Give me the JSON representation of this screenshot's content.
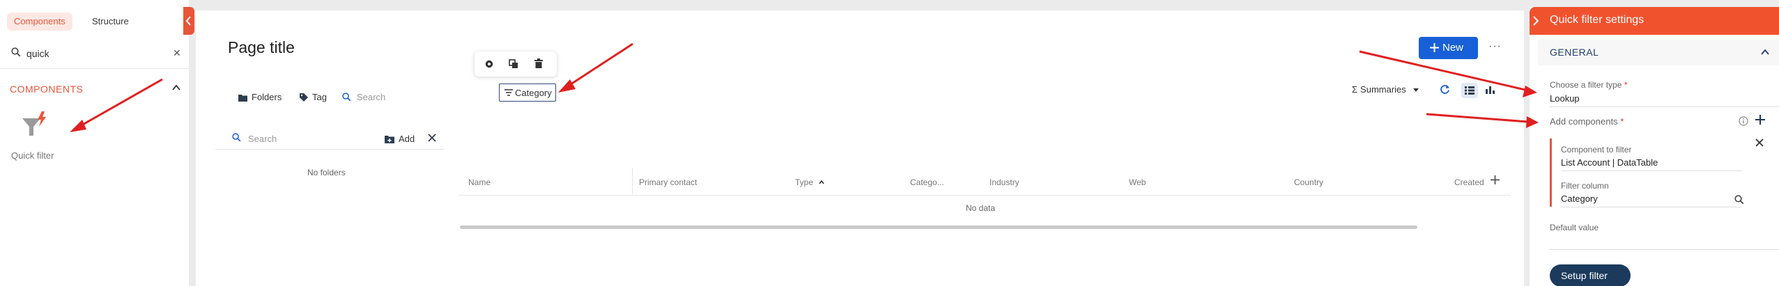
{
  "left_panel": {
    "tabs": [
      {
        "label": "Components",
        "active": true
      },
      {
        "label": "Structure",
        "active": false
      }
    ],
    "search": {
      "value": "quick",
      "clear_icon": "close-icon"
    },
    "section_title": "COMPONENTS",
    "component_item": {
      "label": "Quick filter",
      "icon": "quick-filter-icon"
    }
  },
  "canvas": {
    "page_title": "Page title",
    "floating_toolbar": {
      "icons": [
        "gear-icon",
        "copy-icon",
        "trash-icon"
      ]
    },
    "category_chip": "Category",
    "new_button": "New",
    "more_button": "···",
    "toolbar": {
      "folders": "Folders",
      "tag": "Tag",
      "search_placeholder": "Search"
    },
    "view_controls": {
      "summaries": "Summaries"
    },
    "folder_panel": {
      "search_placeholder": "Search",
      "add_label": "Add",
      "empty_text": "No folders"
    },
    "grid": {
      "columns": [
        "Name",
        "Primary contact",
        "Type",
        "Catego...",
        "Industry",
        "Web",
        "Country",
        "Created"
      ],
      "empty_text": "No data"
    }
  },
  "right_panel": {
    "title": "Quick filter settings",
    "section": "GENERAL",
    "filter_type": {
      "label": "Choose a filter type",
      "value": "Lookup"
    },
    "add_components_label": "Add components",
    "component_card": {
      "component_label": "Component to filter",
      "component_value": "List Account | DataTable",
      "column_label": "Filter column",
      "column_value": "Category"
    },
    "default_value_label": "Default value",
    "setup_button": "Setup filter"
  },
  "colors": {
    "accent": "#f0522e",
    "primary_button": "#1760d8",
    "dark_button": "#1b3a5c",
    "annotation_arrow": "#e02020"
  }
}
